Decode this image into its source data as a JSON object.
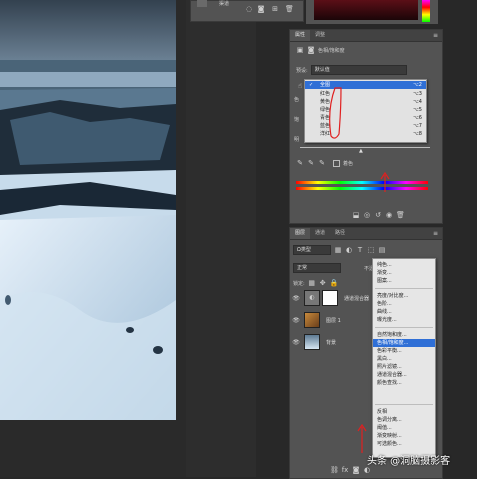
{
  "top_mini_panel": {
    "label": "渠道"
  },
  "properties_panel": {
    "tabs": [
      "属性",
      "调整"
    ],
    "title": "色相/饱和度",
    "preset_label": "预设:",
    "preset_value": "默认值",
    "left_labels": [
      "色",
      "饱",
      "明"
    ],
    "colorize_label": "着色",
    "footer_icons": [
      "clip-icon",
      "eye-visibility-icon",
      "reset-icon",
      "toggle-visibility-icon",
      "trash-icon"
    ]
  },
  "channel_menu": {
    "items": [
      {
        "label": "全图",
        "shortcut": "⌥2",
        "selected": true
      },
      {
        "label": "红色",
        "shortcut": "⌥3",
        "selected": false
      },
      {
        "label": "黄色",
        "shortcut": "⌥4",
        "selected": false
      },
      {
        "label": "绿色",
        "shortcut": "⌥5",
        "selected": false
      },
      {
        "label": "青色",
        "shortcut": "⌥6",
        "selected": false
      },
      {
        "label": "蓝色",
        "shortcut": "⌥7",
        "selected": false
      },
      {
        "label": "洋红",
        "shortcut": "⌥8",
        "selected": false
      }
    ]
  },
  "layers_panel": {
    "tabs": [
      "图层",
      "通道",
      "路径"
    ],
    "kind_label": "Ω类型",
    "blend_mode": "正常",
    "opacity_label": "不透明",
    "lock_label": "锁定:",
    "layers": [
      {
        "name": "通道混合器",
        "type": "adjustment"
      },
      {
        "name": "图层 1",
        "type": "image"
      },
      {
        "name": "背景",
        "type": "image"
      }
    ]
  },
  "adjustment_menu": {
    "groups": [
      [
        "纯色...",
        "渐变...",
        "图案..."
      ],
      [
        "亮度/对比度...",
        "色阶...",
        "曲线...",
        "曝光度..."
      ],
      [
        "自然饱和度...",
        "色相/饱和度...",
        "色彩平衡...",
        "黑白...",
        "照片滤镜...",
        "通道混合器...",
        "颜色查找..."
      ],
      [
        "反相",
        "色调分离...",
        "阈值...",
        "渐变映射...",
        "可选颜色..."
      ]
    ],
    "selected": "色相/饱和度..."
  },
  "watermark": {
    "text": "头条 @洞脑摄影客"
  },
  "colors": {
    "accent": "#2f6fd6",
    "annotation": "#e02020"
  }
}
